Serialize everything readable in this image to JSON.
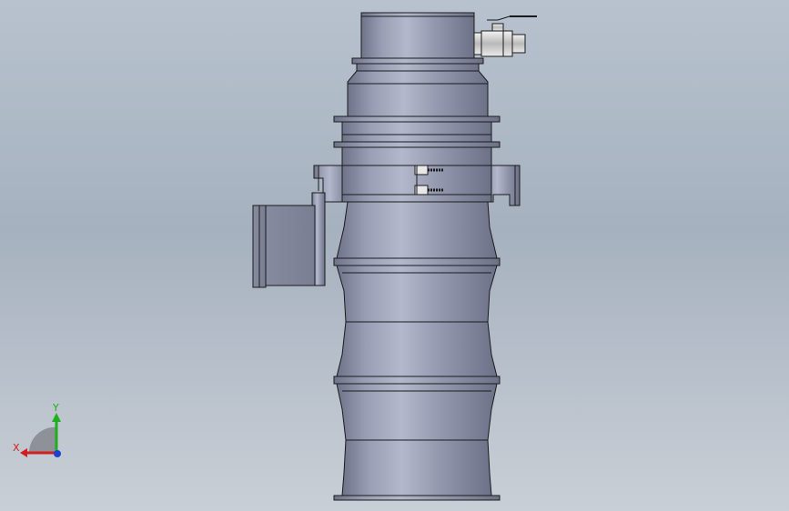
{
  "viewport": {
    "background_top": "#b8c2cf",
    "background_bottom": "#c9cfd6"
  },
  "model": {
    "body_color": "#8d92a8",
    "body_highlight": "#b3b7cb",
    "body_shadow": "#6d7187",
    "edge_color": "#1a1a1a",
    "valve_color": "#d8d8d8"
  },
  "triad": {
    "x_label": "X",
    "y_label": "Y",
    "x_color": "#d11f1f",
    "y_color": "#1fae1f",
    "z_color": "#1f3fd1"
  }
}
